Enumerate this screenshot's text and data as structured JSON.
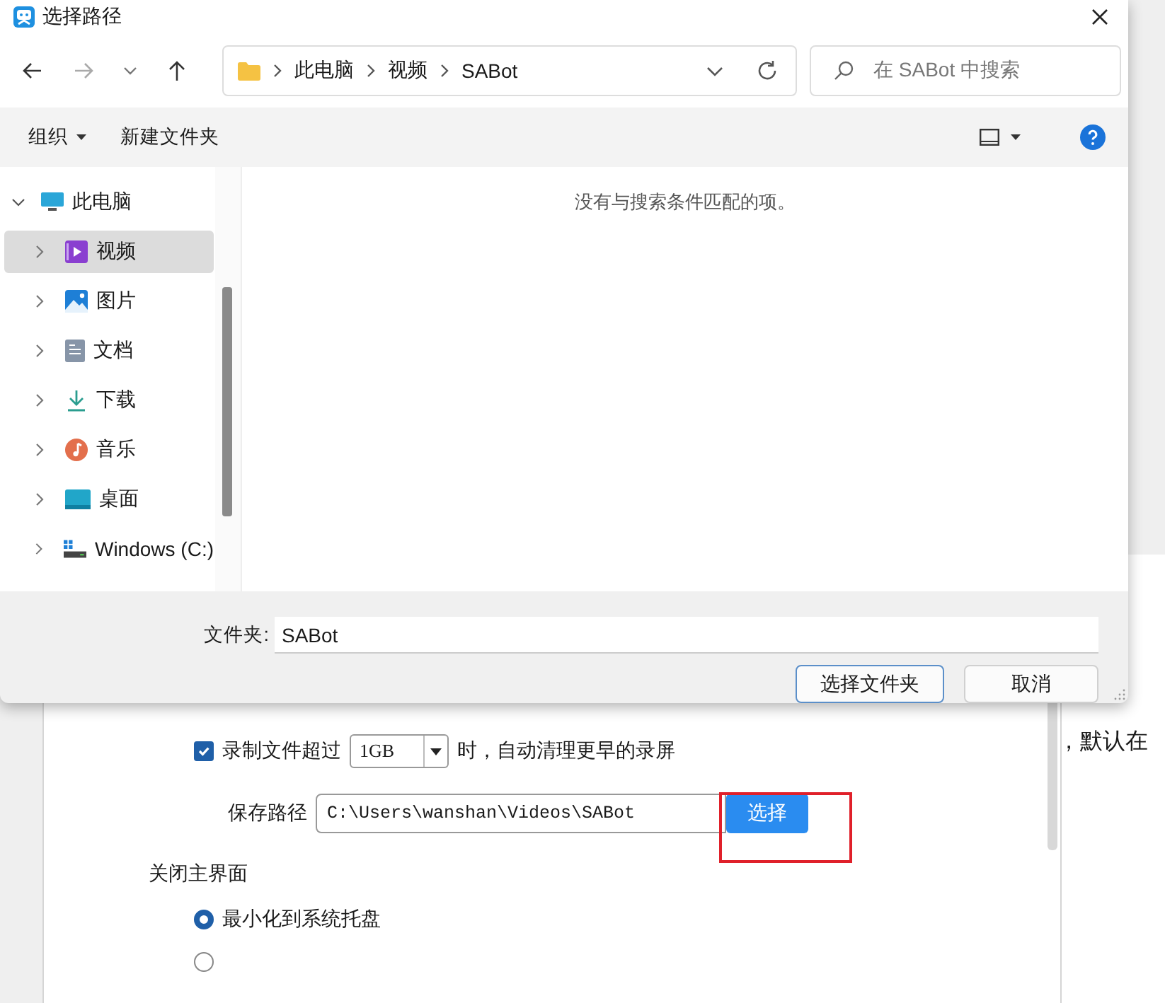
{
  "dialog": {
    "title": "选择路径",
    "breadcrumb": [
      "此电脑",
      "视频",
      "SABot"
    ],
    "search": {
      "placeholder": "在 SABot 中搜索"
    },
    "toolbar": {
      "organize": "组织",
      "new_folder": "新建文件夹"
    },
    "nav_tree": {
      "label": "此电脑",
      "expanded": true,
      "children": [
        {
          "label": "视频",
          "kind": "video",
          "selected": true
        },
        {
          "label": "图片",
          "kind": "picture",
          "selected": false
        },
        {
          "label": "文档",
          "kind": "document",
          "selected": false
        },
        {
          "label": "下载",
          "kind": "download",
          "selected": false
        },
        {
          "label": "音乐",
          "kind": "music",
          "selected": false
        },
        {
          "label": "桌面",
          "kind": "desktop",
          "selected": false
        },
        {
          "label": "Windows (C:)",
          "kind": "drive",
          "selected": false
        }
      ]
    },
    "empty_message": "没有与搜索条件匹配的项。",
    "folder_field": {
      "label": "文件夹:",
      "value": "SABot"
    },
    "buttons": [
      "选择文件夹",
      "取消"
    ]
  },
  "settings": {
    "size_limit": {
      "checked": true,
      "label": "录制文件超过",
      "value": "1GB",
      "suffix": "时，自动清理更早的录屏"
    },
    "save_path": {
      "label": "保存路径",
      "value": "C:\\Users\\wanshan\\Videos\\SABot",
      "button": "选择"
    },
    "close_section": {
      "title": "关闭主界面",
      "options": [
        {
          "label": "最小化到系统托盘",
          "selected": true
        },
        {
          "selected": false
        }
      ]
    }
  },
  "side_text": "，默认在"
}
